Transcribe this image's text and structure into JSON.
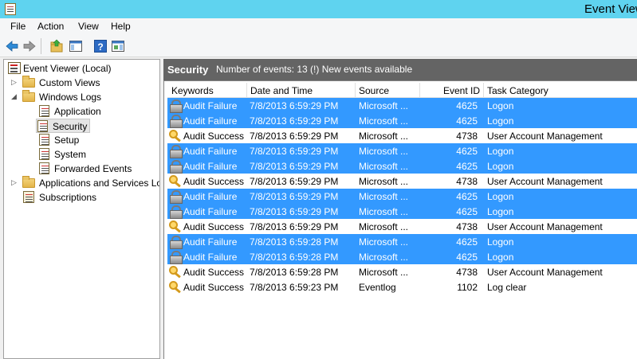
{
  "window": {
    "title": "Event View"
  },
  "menu": {
    "items": [
      "File",
      "Action",
      "View",
      "Help"
    ]
  },
  "tree": {
    "root": "Event Viewer (Local)",
    "custom_views": "Custom Views",
    "windows_logs": "Windows Logs",
    "application": "Application",
    "security": "Security",
    "setup": "Setup",
    "system": "System",
    "forwarded_events": "Forwarded Events",
    "apps_services": "Applications and Services Lo",
    "subscriptions": "Subscriptions"
  },
  "header": {
    "title": "Security",
    "count": "Number of events: 13 (!) New events available"
  },
  "columns": {
    "keywords": "Keywords",
    "date_time": "Date and Time",
    "source": "Source",
    "event_id": "Event ID",
    "task_category": "Task Category"
  },
  "events": [
    {
      "keyword": "Audit Failure",
      "date": "7/8/2013 6:59:29 PM",
      "source": "Microsoft ...",
      "id": "4625",
      "category": "Logon",
      "icon": "lock-icon",
      "selected": true
    },
    {
      "keyword": "Audit Failure",
      "date": "7/8/2013 6:59:29 PM",
      "source": "Microsoft ...",
      "id": "4625",
      "category": "Logon",
      "icon": "lock-icon",
      "selected": true
    },
    {
      "keyword": "Audit Success",
      "date": "7/8/2013 6:59:29 PM",
      "source": "Microsoft ...",
      "id": "4738",
      "category": "User Account Management",
      "icon": "key-icon",
      "selected": false
    },
    {
      "keyword": "Audit Failure",
      "date": "7/8/2013 6:59:29 PM",
      "source": "Microsoft ...",
      "id": "4625",
      "category": "Logon",
      "icon": "lock-icon",
      "selected": true
    },
    {
      "keyword": "Audit Failure",
      "date": "7/8/2013 6:59:29 PM",
      "source": "Microsoft ...",
      "id": "4625",
      "category": "Logon",
      "icon": "lock-icon",
      "selected": true
    },
    {
      "keyword": "Audit Success",
      "date": "7/8/2013 6:59:29 PM",
      "source": "Microsoft ...",
      "id": "4738",
      "category": "User Account Management",
      "icon": "key-icon",
      "selected": false
    },
    {
      "keyword": "Audit Failure",
      "date": "7/8/2013 6:59:29 PM",
      "source": "Microsoft ...",
      "id": "4625",
      "category": "Logon",
      "icon": "lock-icon",
      "selected": true
    },
    {
      "keyword": "Audit Failure",
      "date": "7/8/2013 6:59:29 PM",
      "source": "Microsoft ...",
      "id": "4625",
      "category": "Logon",
      "icon": "lock-icon",
      "selected": true
    },
    {
      "keyword": "Audit Success",
      "date": "7/8/2013 6:59:29 PM",
      "source": "Microsoft ...",
      "id": "4738",
      "category": "User Account Management",
      "icon": "key-icon",
      "selected": false
    },
    {
      "keyword": "Audit Failure",
      "date": "7/8/2013 6:59:28 PM",
      "source": "Microsoft ...",
      "id": "4625",
      "category": "Logon",
      "icon": "lock-icon",
      "selected": true
    },
    {
      "keyword": "Audit Failure",
      "date": "7/8/2013 6:59:28 PM",
      "source": "Microsoft ...",
      "id": "4625",
      "category": "Logon",
      "icon": "lock-icon",
      "selected": true
    },
    {
      "keyword": "Audit Success",
      "date": "7/8/2013 6:59:28 PM",
      "source": "Microsoft ...",
      "id": "4738",
      "category": "User Account Management",
      "icon": "key-icon",
      "selected": false
    },
    {
      "keyword": "Audit Success",
      "date": "7/8/2013 6:59:23 PM",
      "source": "Eventlog",
      "id": "1102",
      "category": "Log clear",
      "icon": "key-icon",
      "selected": false
    }
  ],
  "colors": {
    "titlebar": "#5fd3ef",
    "selection": "#3399ff",
    "header_bg": "#646464"
  }
}
